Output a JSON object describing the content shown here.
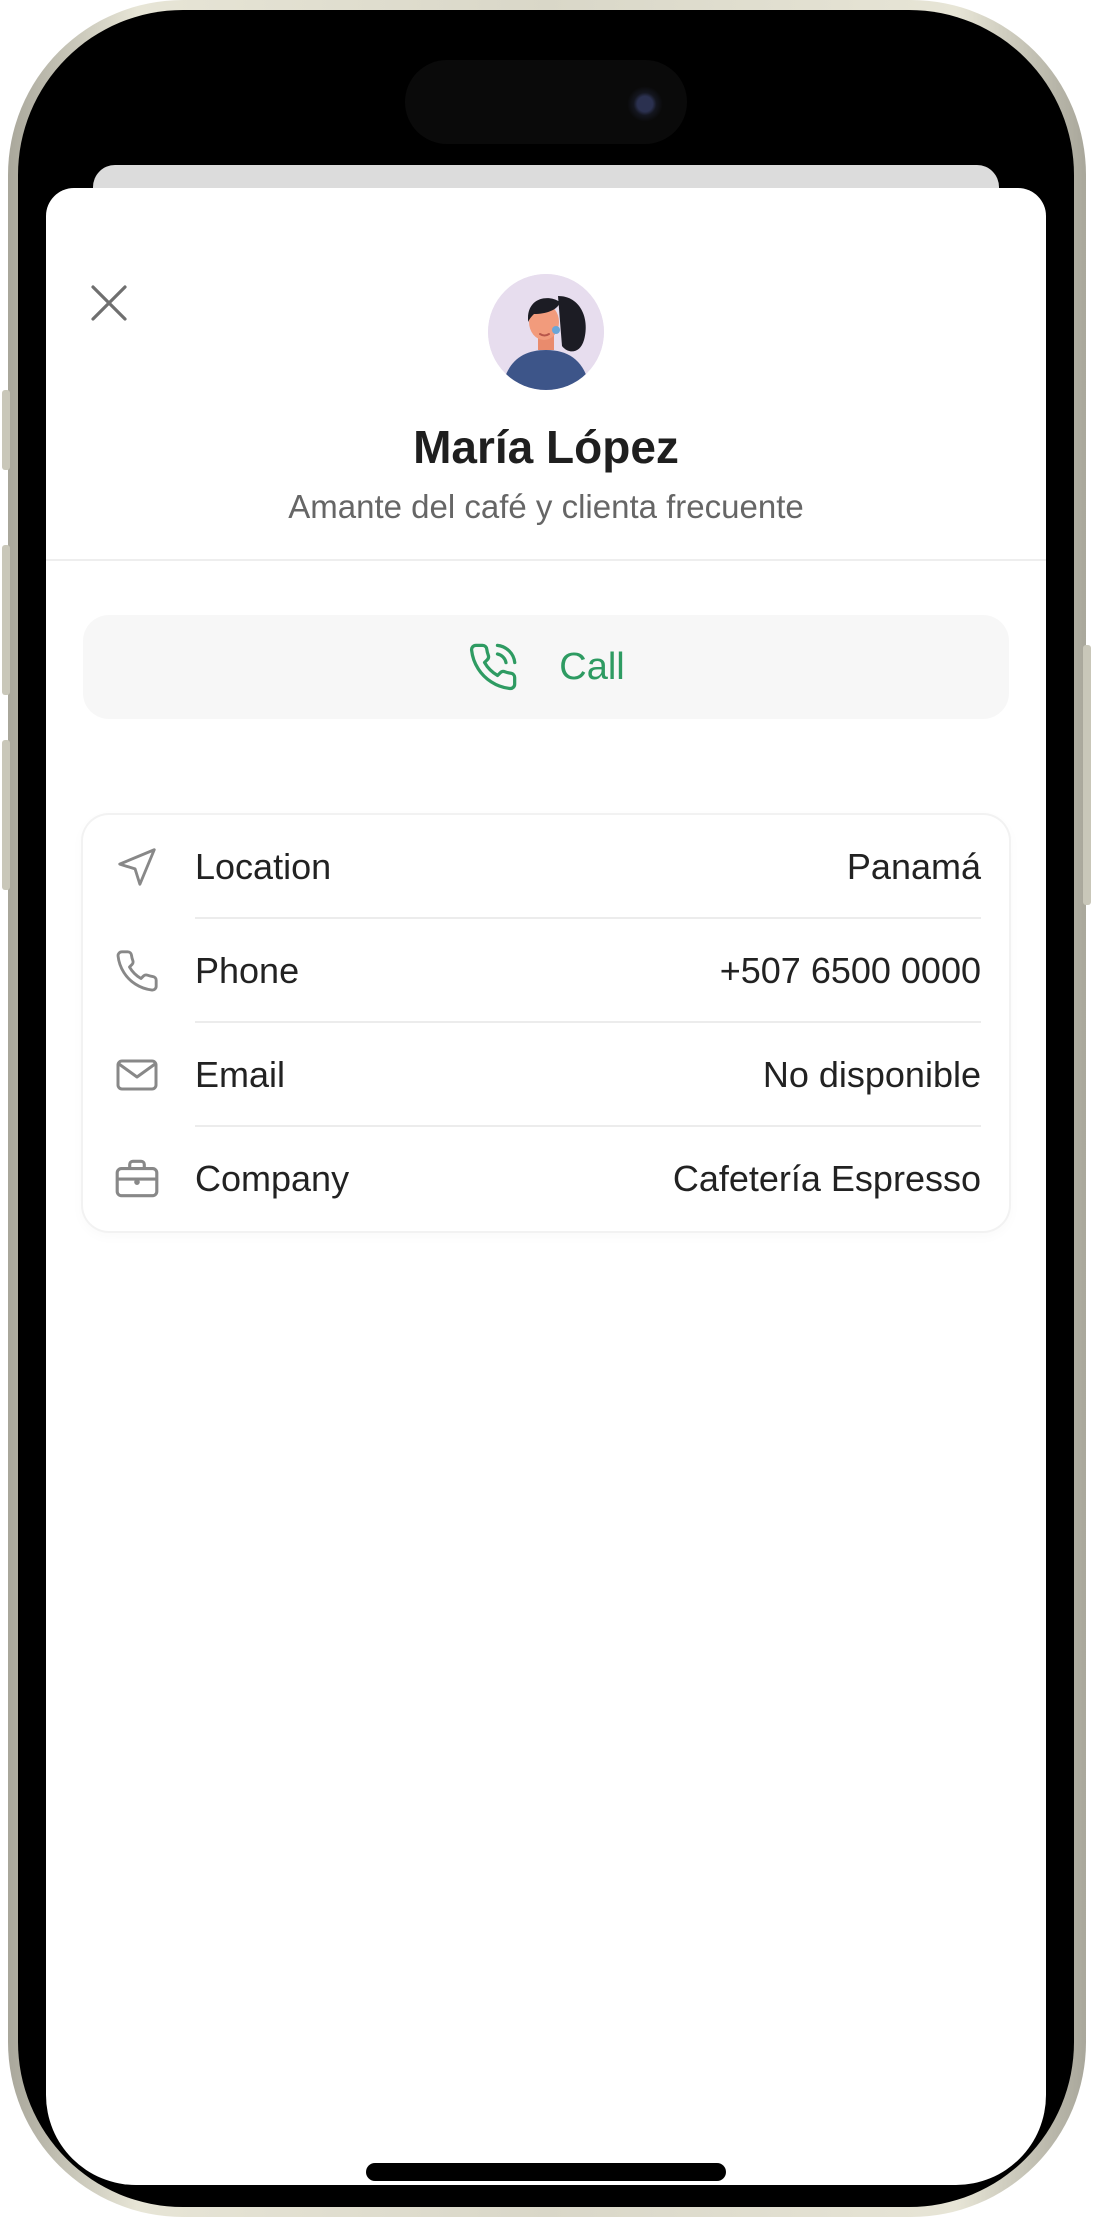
{
  "contact": {
    "name": "María López",
    "subtitle": "Amante del café y clienta frecuente"
  },
  "actions": {
    "call_label": "Call"
  },
  "details": [
    {
      "label": "Location",
      "value": "Panamá",
      "icon": "navigation-arrow-icon"
    },
    {
      "label": "Phone",
      "value": "+507 6500 0000",
      "icon": "phone-icon"
    },
    {
      "label": "Email",
      "value": "No disponible",
      "icon": "mail-icon"
    },
    {
      "label": "Company",
      "value": "Cafetería Espresso",
      "icon": "briefcase-icon"
    }
  ],
  "colors": {
    "accent_green": "#2e9b62",
    "icon_gray": "#888888",
    "text_primary": "#1f1f1f",
    "text_secondary": "#666666"
  }
}
